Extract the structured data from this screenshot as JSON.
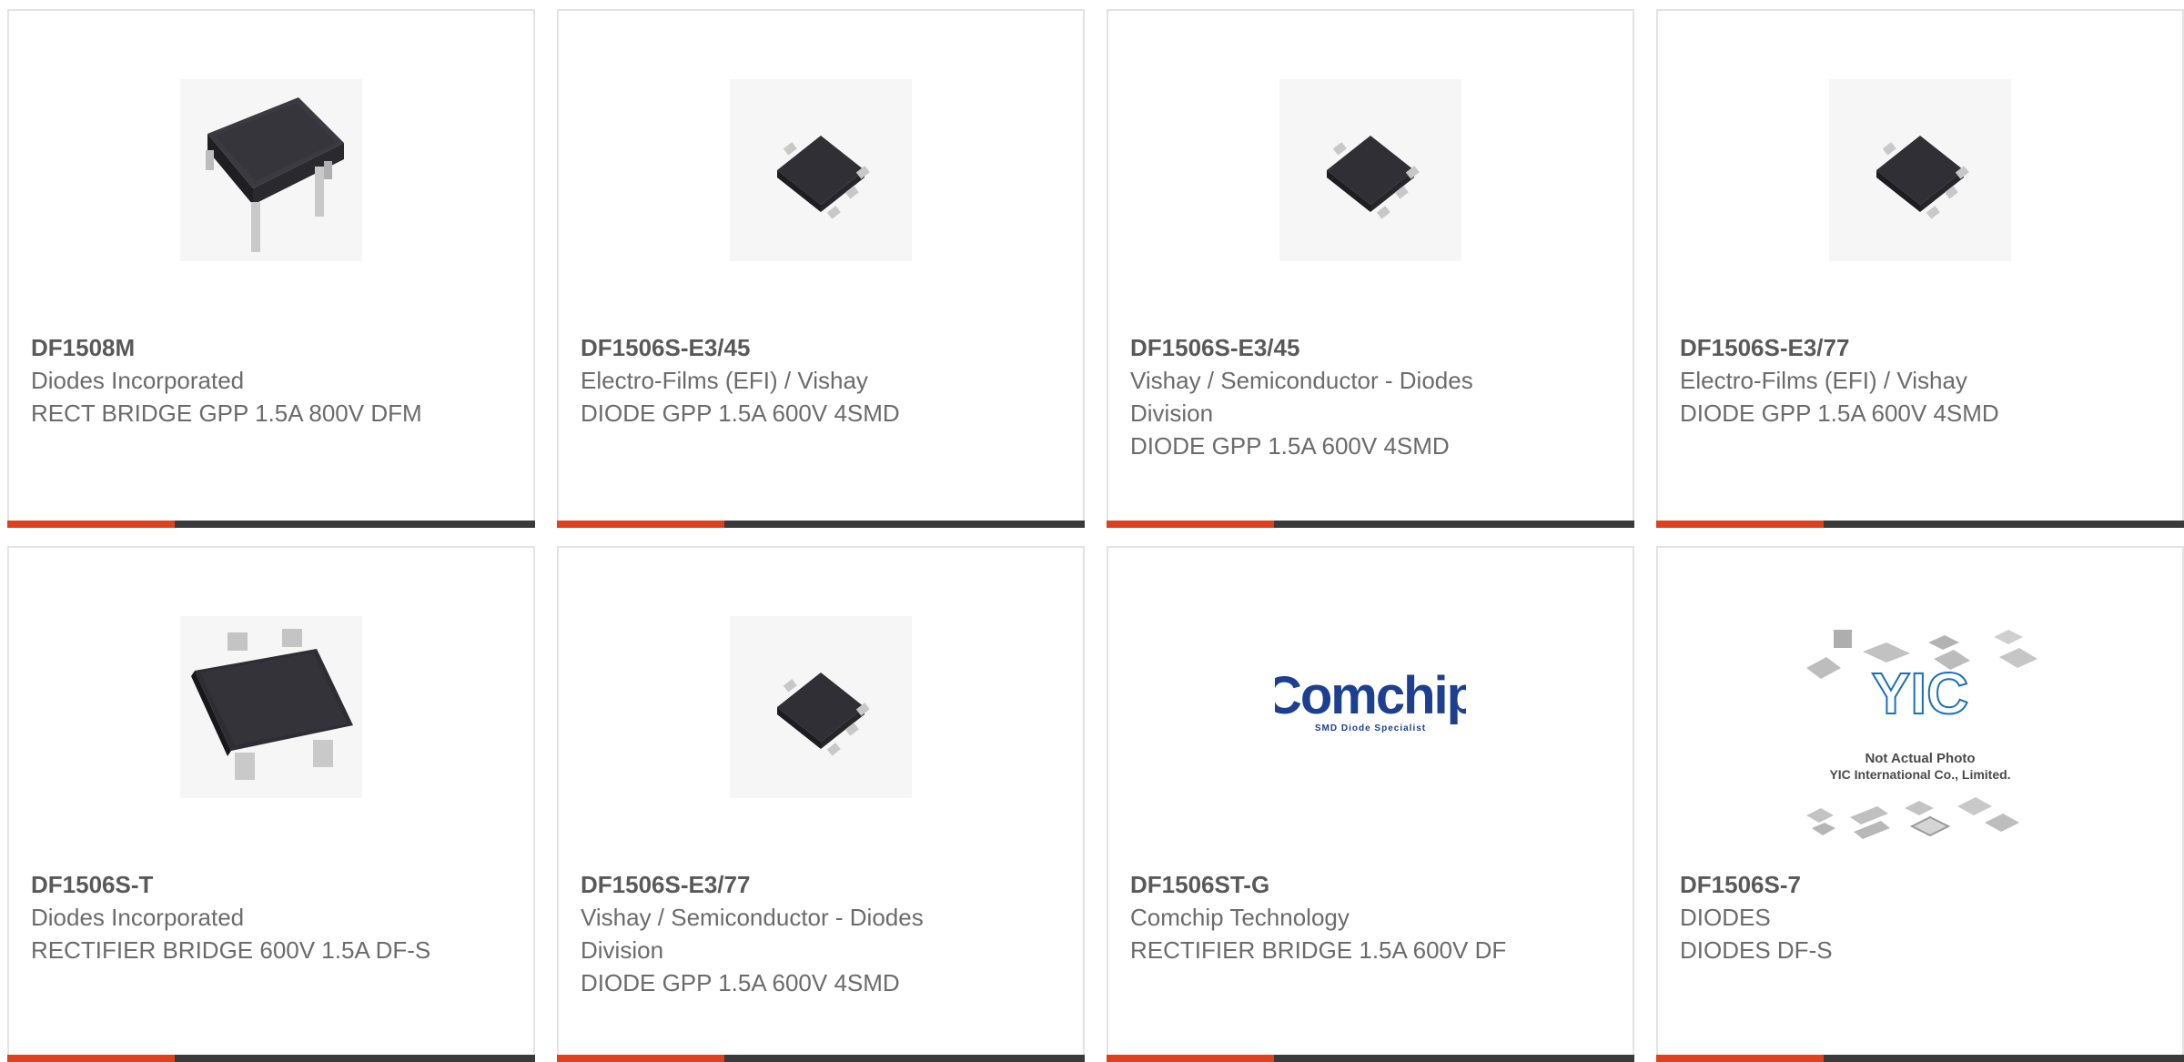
{
  "products": [
    {
      "part": "DF1508M",
      "manufacturer": "Diodes Incorporated",
      "description": "RECT BRIDGE GPP 1.5A 800V DFM",
      "image": "dfm-through-hole-bridge"
    },
    {
      "part": "DF1506S-E3/45",
      "manufacturer": "Electro-Films (EFI) / Vishay",
      "description": "DIODE GPP 1.5A 600V 4SMD",
      "image": "small-smd-bridge"
    },
    {
      "part": "DF1506S-E3/45",
      "manufacturer": "Vishay / Semiconductor - Diodes Division",
      "description": "DIODE GPP 1.5A 600V 4SMD",
      "image": "small-smd-bridge"
    },
    {
      "part": "DF1506S-E3/77",
      "manufacturer": "Electro-Films (EFI) / Vishay",
      "description": "DIODE GPP 1.5A 600V 4SMD",
      "image": "small-smd-bridge"
    },
    {
      "part": "DF1506S-T",
      "manufacturer": "Diodes Incorporated",
      "description": "RECTIFIER BRIDGE 600V 1.5A DF-S",
      "image": "df-s-bridge"
    },
    {
      "part": "DF1506S-E3/77",
      "manufacturer": "Vishay / Semiconductor - Diodes Division",
      "description": "DIODE GPP 1.5A 600V 4SMD",
      "image": "small-smd-bridge"
    },
    {
      "part": "DF1506ST-G",
      "manufacturer": "Comchip Technology",
      "description": "RECTIFIER BRIDGE 1.5A 600V DF",
      "image": "comchip-logo"
    },
    {
      "part": "DF1506S-7",
      "manufacturer": "DIODES",
      "description": "DIODES DF-S",
      "image": "yic-placeholder"
    }
  ],
  "logos": {
    "comchip": {
      "name": "Comchip",
      "tagline": "SMD Diode Specialist",
      "color": "#1d3f8f"
    },
    "yic": {
      "mark": "YIC",
      "line1": "Not Actual Photo",
      "line2": "YIC International Co., Limited.",
      "color": "#1c6fb8"
    }
  },
  "colors": {
    "accent": "#e0401c",
    "bar": "#3a3a3a",
    "border": "#e3e3e3",
    "text": "#6b6b6b"
  }
}
